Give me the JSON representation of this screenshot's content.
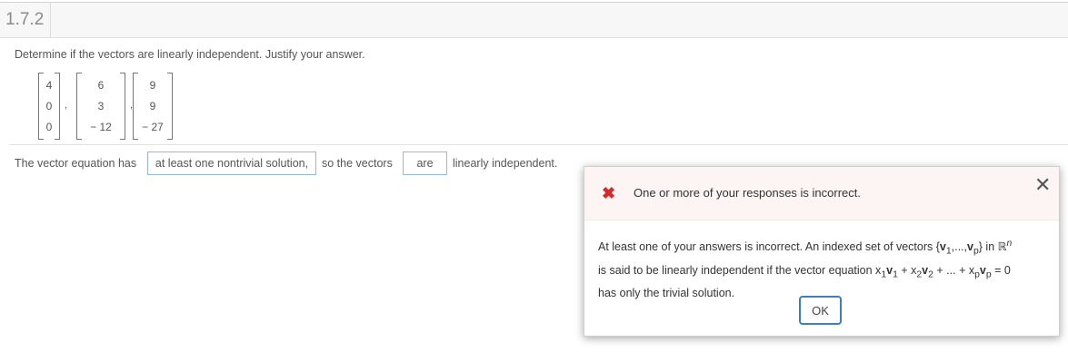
{
  "section": {
    "number": "1.7.2"
  },
  "question": {
    "prompt": "Determine if the vectors are linearly independent. Justify your answer.",
    "vectors": [
      [
        "4",
        "0",
        "0"
      ],
      [
        "6",
        "3",
        "− 12"
      ],
      [
        "9",
        "9",
        "− 27"
      ]
    ],
    "comma": ","
  },
  "answer": {
    "part1": "The vector equation has",
    "box1_value": "at least one nontrivial solution,",
    "part2": "so the vectors",
    "box2_value": "are",
    "part3": "linearly independent."
  },
  "dialog": {
    "title": "One or more of your responses is incorrect.",
    "close_glyph": "✕",
    "error_glyph": "✖",
    "message_part1": "At least one of your answers is incorrect. An indexed set of vectors {",
    "message_v": "v",
    "message_sub1": "1",
    "message_dots": ",...,",
    "message_sub_p": "p",
    "message_part2": "} in ℝ",
    "message_sup_n": "n",
    "message_line2_a": "is said to be linearly independent if the vector equation x",
    "message_line2_b": "+ x",
    "message_line2_c": "+ ... + x",
    "message_line2_d": "= 0",
    "message_sub2": "2",
    "message_line3": "has only the trivial solution.",
    "ok_label": "OK"
  },
  "colors": {
    "error_red": "#d42a2a",
    "ok_border": "#3d7fb6",
    "answer_box_border": "#9ab7d8"
  }
}
